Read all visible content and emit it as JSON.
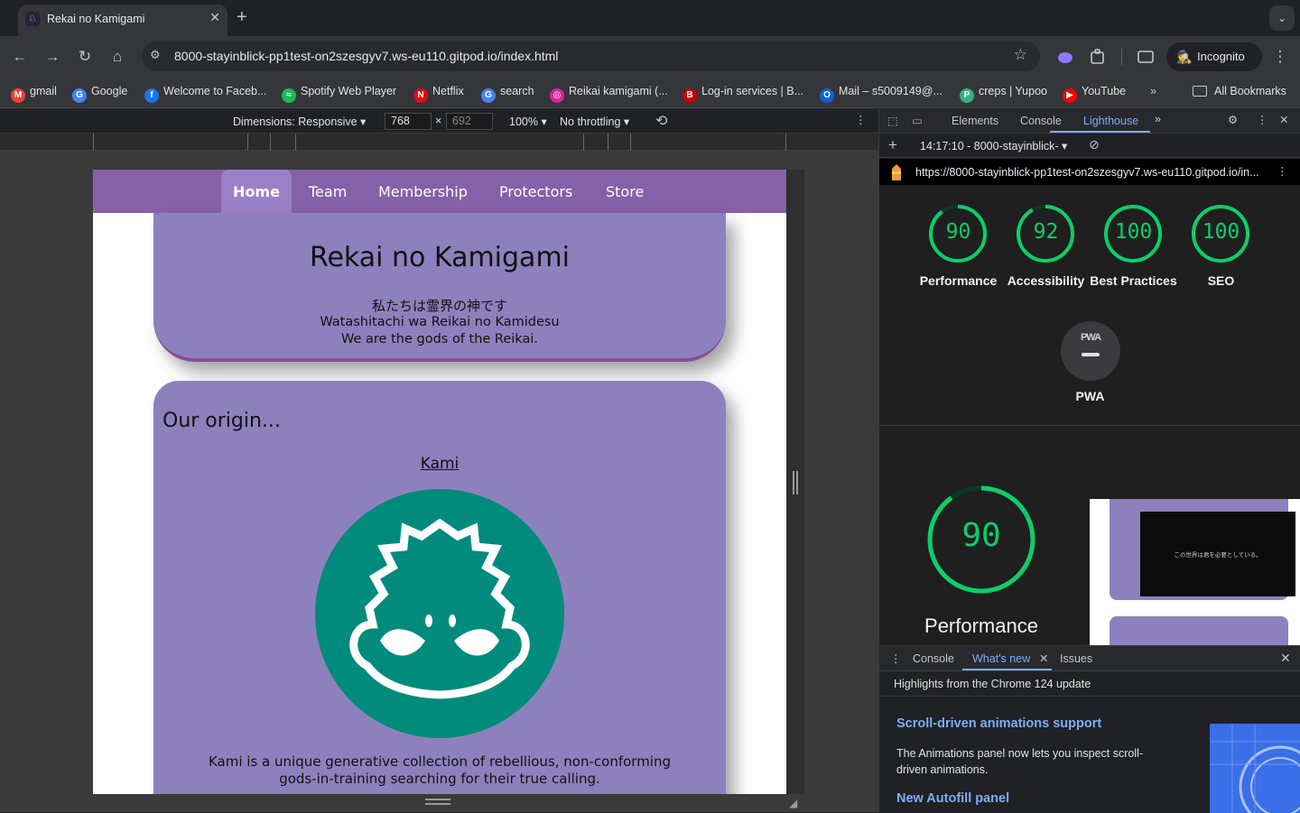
{
  "browser": {
    "tab_title": "Rekai no Kamigami",
    "url": "8000-stayinblick-pp1test-on2szesgyv7.ws-eu110.gitpod.io/index.html",
    "incognito_label": "Incognito"
  },
  "bookmarks": [
    {
      "label": "gmail",
      "icon": "gmail-icon",
      "color": "#ea4335"
    },
    {
      "label": "Google",
      "icon": "google-icon",
      "color": "#4285f4"
    },
    {
      "label": "Welcome to Faceb...",
      "icon": "facebook-icon",
      "color": "#1877f2"
    },
    {
      "label": "Spotify Web Player",
      "icon": "spotify-icon",
      "color": "#1db954"
    },
    {
      "label": "Netflix",
      "icon": "netflix-icon",
      "color": "#e50914"
    },
    {
      "label": "search",
      "icon": "google-icon",
      "color": "#4285f4"
    },
    {
      "label": "Reikai kamigami (...",
      "icon": "instagram-icon",
      "color": "#d6249f"
    },
    {
      "label": "Log-in services | B...",
      "icon": "bu-icon",
      "color": "#cc0000"
    },
    {
      "label": "Mail – s5009149@...",
      "icon": "outlook-icon",
      "color": "#0a64d6"
    },
    {
      "label": "creps | Yupoo",
      "icon": "yupoo-icon",
      "color": "#2fb380"
    },
    {
      "label": "YouTube",
      "icon": "youtube-icon",
      "color": "#ff0000"
    }
  ],
  "bookmarks_all": "All Bookmarks",
  "device_toolbar": {
    "dimensions": "Dimensions: Responsive",
    "width": "768",
    "times": "×",
    "height": "692",
    "zoom": "100%",
    "throttling": "No throttling"
  },
  "site": {
    "nav": [
      "Home",
      "Team",
      "Membership",
      "Protectors",
      "Store"
    ],
    "active_nav": "Home",
    "hero_title": "Rekai no Kamigami",
    "hero_jp": "私たちは霊界の神です",
    "hero_romaji": "Watashitachi wa Reikai no Kamidesu",
    "hero_en": "We are the gods of the Reikai.",
    "origin_heading": "Our origin...",
    "kami_link": "Kami",
    "kami_desc": "Kami is a unique generative collection of rebellious, non-conforming gods-in-training searching for their true calling.",
    "colors": {
      "nav": "#8461a8",
      "card": "#8d81bd",
      "logo_bg": "#008b7d"
    }
  },
  "devtools": {
    "tabs": [
      "Elements",
      "Console",
      "Lighthouse"
    ],
    "active_tab": "Lighthouse",
    "report_select": "14:17:10 - 8000-stayinblick-",
    "report_url": "https://8000-stayinblick-pp1test-on2szesgyv7.ws-eu110.gitpod.io/in...",
    "scores": [
      {
        "label": "Performance",
        "value": "90",
        "score": 0.9
      },
      {
        "label": "Accessibility",
        "value": "92",
        "score": 0.92
      },
      {
        "label": "Best Practices",
        "value": "100",
        "score": 1.0
      },
      {
        "label": "SEO",
        "value": "100",
        "score": 1.0
      }
    ],
    "pwa_badge": "PWA",
    "pwa_label": "PWA",
    "big_score": {
      "value": "90",
      "label": "Performance",
      "score": 0.9
    },
    "thumbnail_caption": "この世界は君を必要としている。",
    "score_color": "#0cce6b",
    "drawer": {
      "tabs": [
        "Console",
        "What's new",
        "Issues"
      ],
      "active_tab": "What's new",
      "highlights": "Highlights from the Chrome 124 update",
      "item1_title": "Scroll-driven animations support",
      "item1_body": "The Animations panel now lets you inspect scroll-driven animations.",
      "item2_title": "New Autofill panel"
    }
  }
}
